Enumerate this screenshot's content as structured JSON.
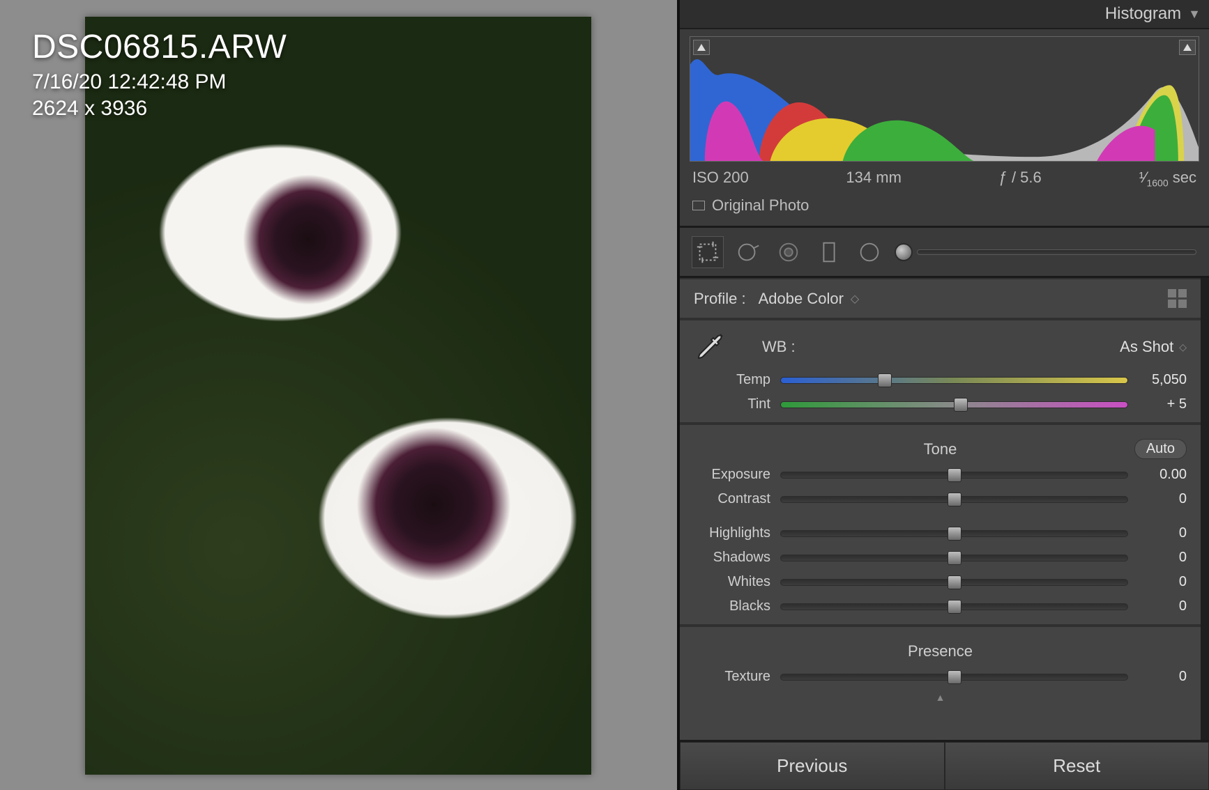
{
  "preview": {
    "filename": "DSC06815.ARW",
    "timestamp": "7/16/20 12:42:48 PM",
    "dimensions": "2624 x 3936"
  },
  "panel": {
    "header": "Histogram"
  },
  "exif": {
    "iso": "ISO 200",
    "focal": "134 mm",
    "aperture": "ƒ / 5.6",
    "shutter_prefix": "¹⁄",
    "shutter_denom": "1600",
    "shutter_suffix": " sec"
  },
  "original_photo_label": "Original Photo",
  "profile": {
    "label": "Profile :",
    "value": "Adobe Color"
  },
  "wb": {
    "label": "WB :",
    "mode": "As Shot",
    "temp_label": "Temp",
    "temp_value": "5,050",
    "temp_pct": 30,
    "tint_label": "Tint",
    "tint_value": "+ 5",
    "tint_pct": 52
  },
  "tone": {
    "title": "Tone",
    "auto": "Auto",
    "exposure_label": "Exposure",
    "exposure_value": "0.00",
    "contrast_label": "Contrast",
    "contrast_value": "0",
    "highlights_label": "Highlights",
    "highlights_value": "0",
    "shadows_label": "Shadows",
    "shadows_value": "0",
    "whites_label": "Whites",
    "whites_value": "0",
    "blacks_label": "Blacks",
    "blacks_value": "0"
  },
  "presence": {
    "title": "Presence",
    "texture_label": "Texture",
    "texture_value": "0"
  },
  "buttons": {
    "previous": "Previous",
    "reset": "Reset"
  }
}
